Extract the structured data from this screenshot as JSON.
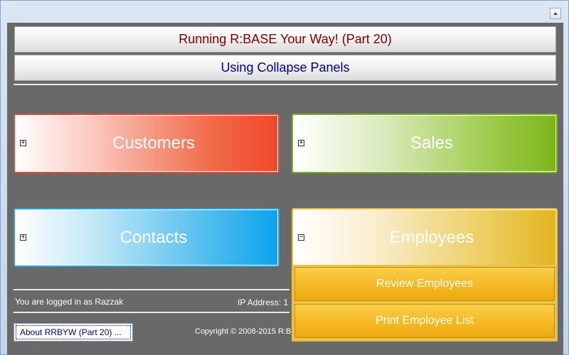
{
  "window": {
    "control_icon": "scroll-up-icon"
  },
  "header": {
    "title": "Running R:BASE Your Way! (Part 20)",
    "subtitle": "Using Collapse Panels"
  },
  "panels": [
    {
      "label": "Customers",
      "expander": "+",
      "state": "collapsed",
      "color": "#f0482a"
    },
    {
      "label": "Sales",
      "expander": "+",
      "state": "collapsed",
      "color": "#7bb61a"
    },
    {
      "label": "Contacts",
      "expander": "+",
      "state": "collapsed",
      "color": "#0aa3ec"
    },
    {
      "label": "Employees",
      "expander": "−",
      "state": "expanded",
      "color": "#e2b420"
    }
  ],
  "employees_menu": {
    "items": [
      "Review Employees",
      "Print Employee List"
    ]
  },
  "status": {
    "logged_in": "You are logged in as Razzak",
    "ip_address": "IP Address: 1"
  },
  "footer": {
    "about_button": "About RRBYW (Part 20) ...",
    "copyright": "Copyright ©  2008-2015 R:B"
  }
}
